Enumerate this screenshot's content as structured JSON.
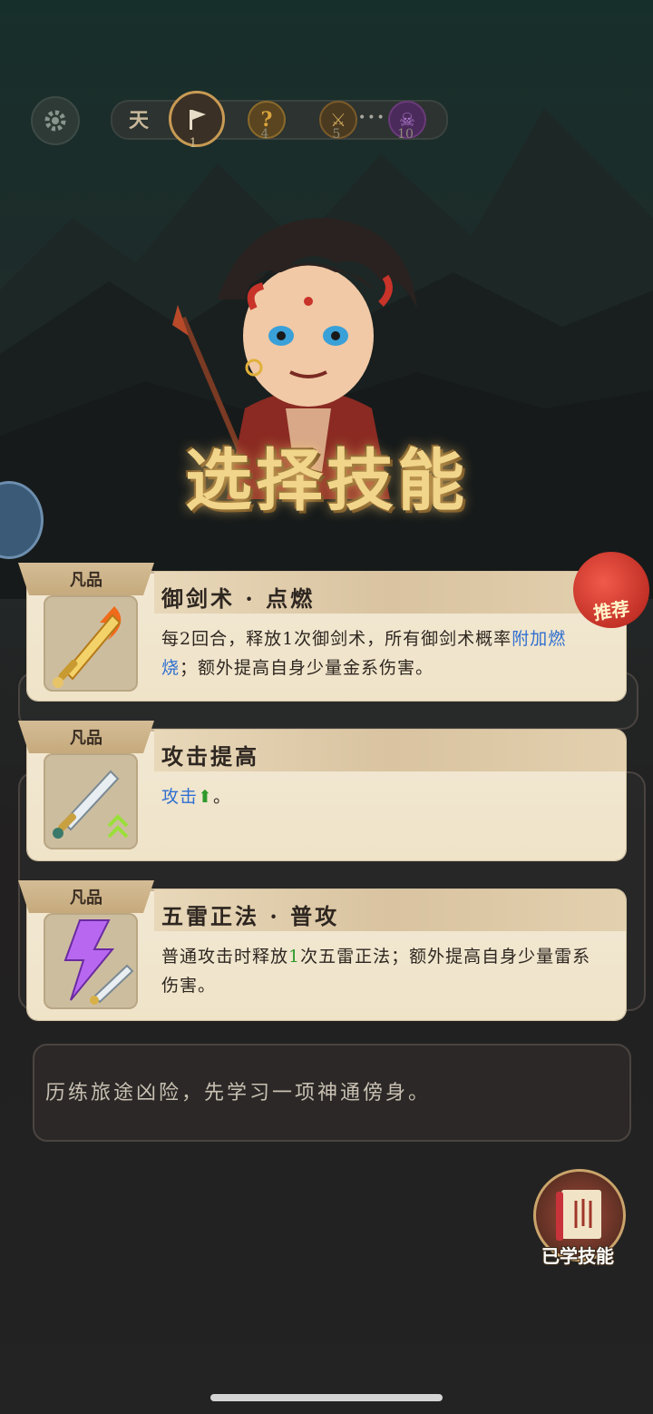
{
  "stage_bar": {
    "stages": [
      {
        "label": "1"
      },
      {
        "label": "4"
      },
      {
        "label": "5"
      },
      {
        "label": "10"
      }
    ]
  },
  "title": "选择技能",
  "skills": [
    {
      "rarity": "凡品",
      "name": "御剑术 · 点燃",
      "desc_parts": [
        "每2回合，释放1次御剑术，所有御剑术概率",
        "附加燃烧",
        "；额外提高自身少量金系伤害。"
      ],
      "recommended_label": "推荐"
    },
    {
      "rarity": "凡品",
      "name": "攻击提高",
      "desc_parts": [
        "攻击",
        "⬆",
        "。"
      ]
    },
    {
      "rarity": "凡品",
      "name": "五雷正法 · 普攻",
      "desc_parts": [
        "普通攻击时释放",
        "1",
        "次五雷正法；额外提高自身少量雷系伤害。"
      ]
    }
  ],
  "hint": "历练旅途凶险，先学习一项神通傍身。",
  "learned_skills_label": "已学技能",
  "colors": {
    "accent_blue": "#2f6fd1",
    "accent_green": "#2f9a2c",
    "title_gold": "#f1d58a"
  }
}
